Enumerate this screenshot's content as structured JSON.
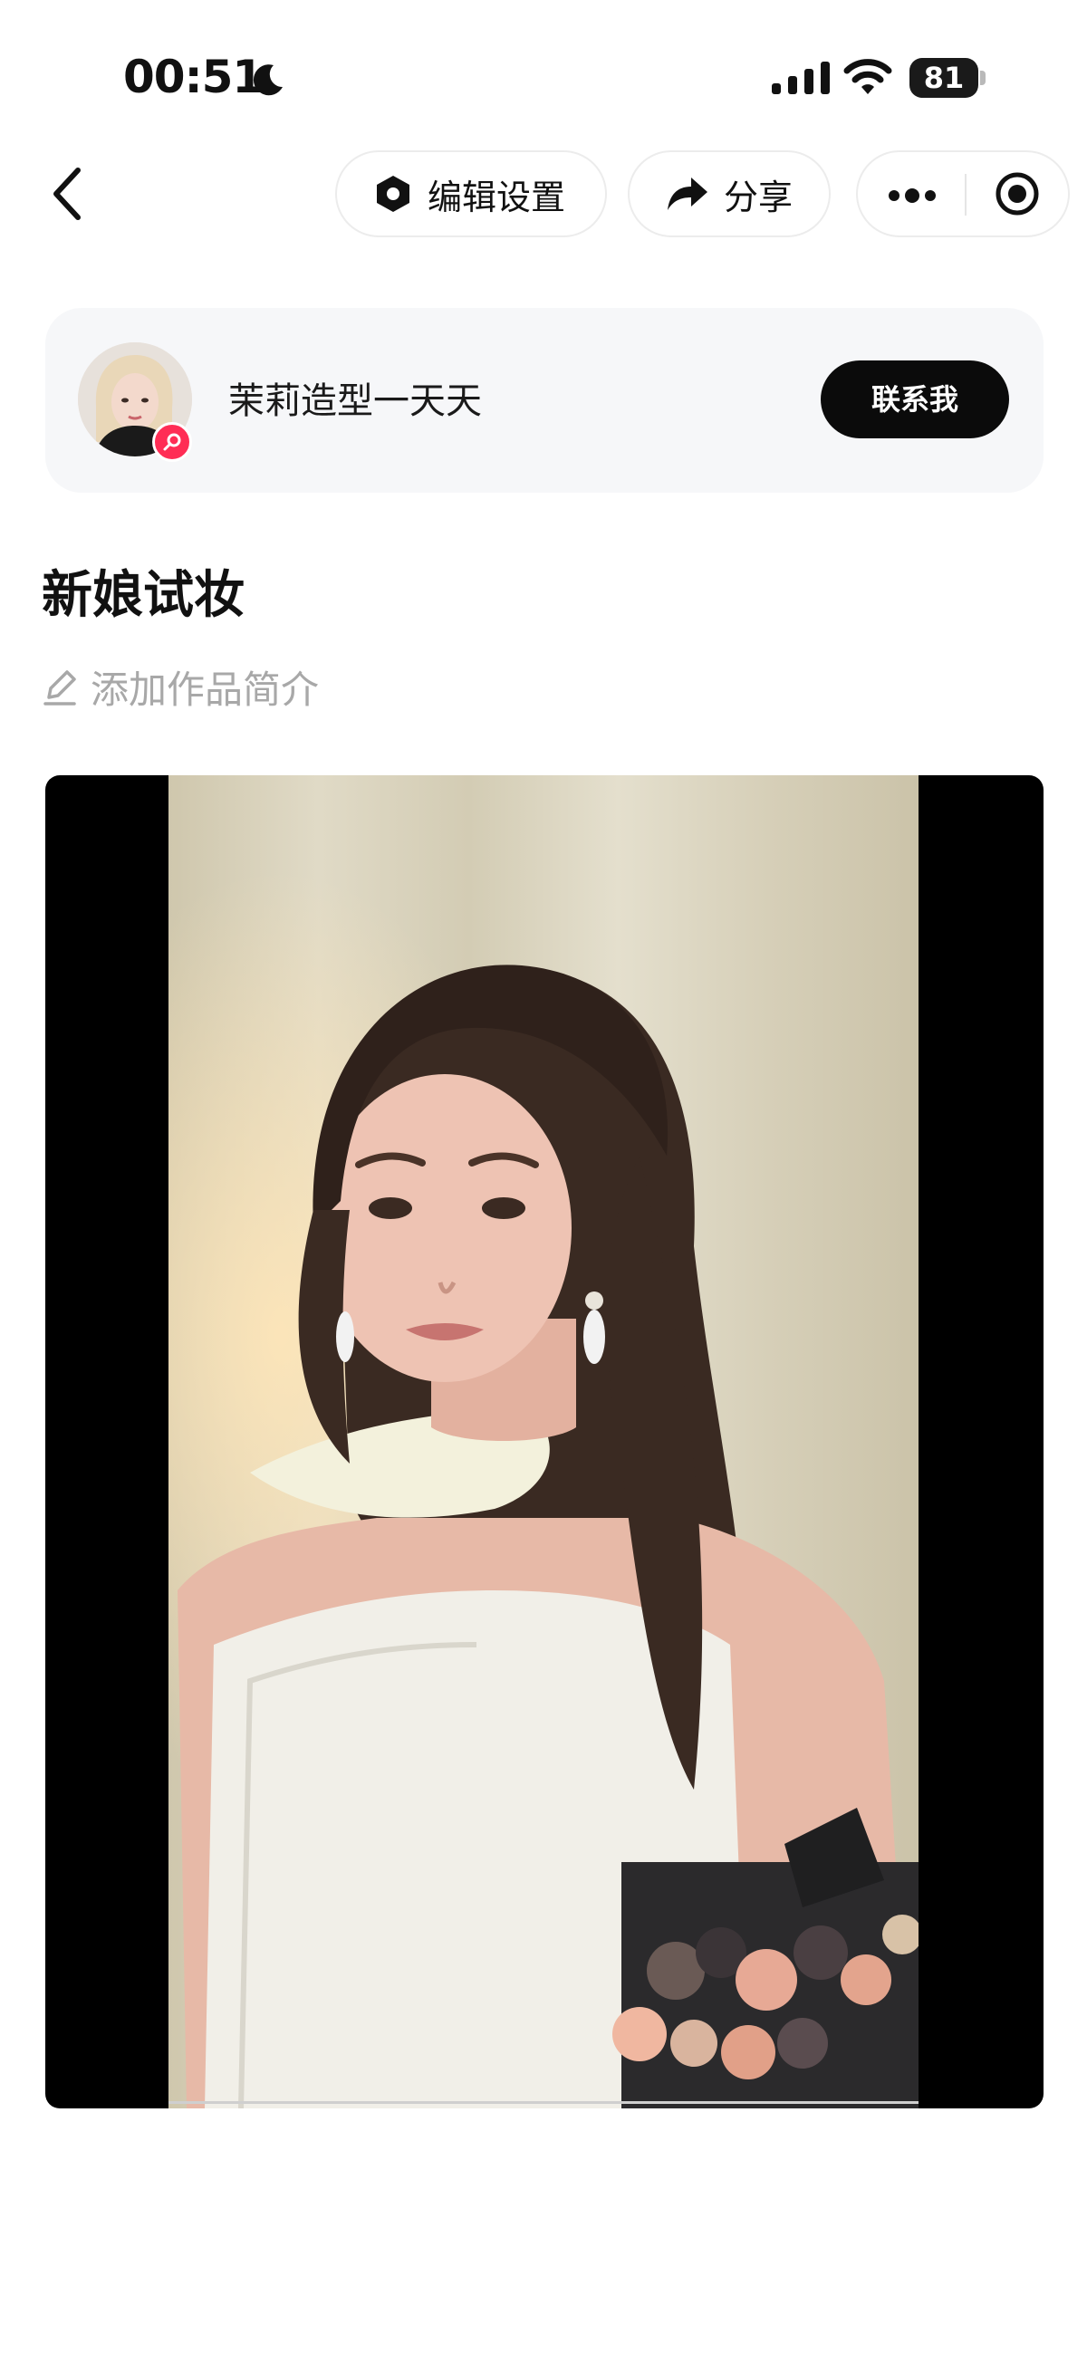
{
  "status_bar": {
    "time": "00:51",
    "battery_level": "81",
    "icons": [
      "moon-icon",
      "cellular-signal-icon",
      "wifi-icon",
      "battery-icon"
    ]
  },
  "nav": {
    "back_icon": "chevron-left-icon",
    "edit_settings_label": "编辑设置",
    "share_label": "分享",
    "more_icon": "more-dots-icon",
    "close_icon": "target-circle-icon"
  },
  "author": {
    "name": "茉莉造型一天天",
    "contact_label": "联系我",
    "badge_icon": "search-badge-icon"
  },
  "post": {
    "title": "新娘试妆",
    "desc_placeholder": "添加作品简介"
  },
  "colors": {
    "accent": "#ff2d55",
    "button_dark": "#0b0b0b",
    "card_bg": "#f6f7f9",
    "placeholder_text": "#a8a8a8"
  }
}
